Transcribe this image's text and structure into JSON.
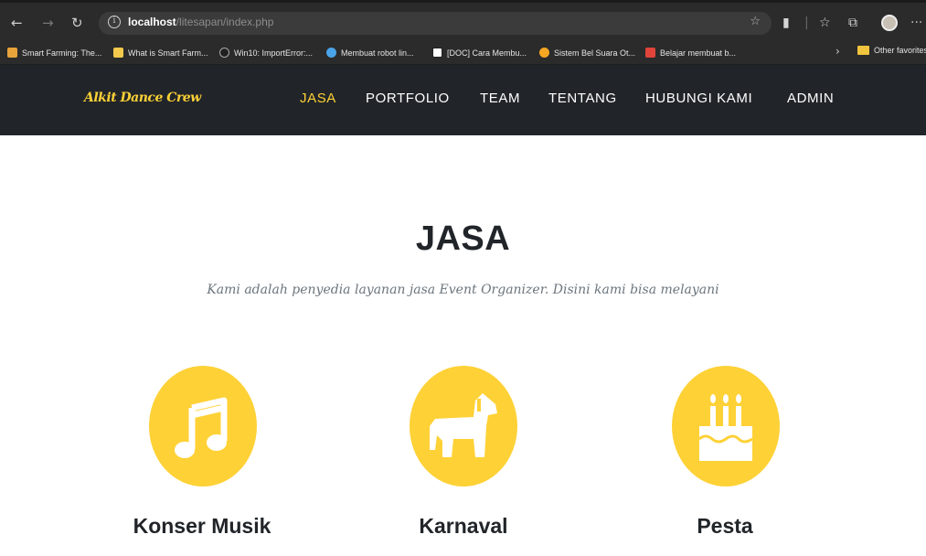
{
  "browser": {
    "url_host": "localhost",
    "url_path": "/litesapan/index.php",
    "bookmarks": [
      {
        "label": "Smart Farming: The...",
        "color": "#e8a33a"
      },
      {
        "label": "What is Smart Farm...",
        "color": "#f2c94c"
      },
      {
        "label": "Win10: ImportError:...",
        "color": "#202020"
      },
      {
        "label": "Membuat robot lin...",
        "color": "#4aa3e8"
      },
      {
        "label": "[DOC] Cara Membu...",
        "color": "#ffffff"
      },
      {
        "label": "Sistem Bel Suara Ot...",
        "color": "#f5a623"
      },
      {
        "label": "Belajar membuat b...",
        "color": "#e0443a"
      }
    ],
    "other_bookmarks": "Other favorites"
  },
  "navbar": {
    "brand": "Alkit Dance Crew",
    "items": [
      "JASA",
      "PORTFOLIO",
      "TEAM",
      "TENTANG",
      "HUBUNGI KAMI",
      "ADMIN"
    ],
    "active_item": "JASA"
  },
  "services": {
    "heading": "JASA",
    "subheading": "Kami adalah penyedia layanan jasa Event Organizer. Disini kami bisa melayani",
    "items": [
      {
        "title": "Konser Musik",
        "icon": "music-note-icon"
      },
      {
        "title": "Karnaval",
        "icon": "horse-icon"
      },
      {
        "title": "Pesta",
        "icon": "birthday-cake-icon"
      }
    ]
  },
  "colors": {
    "accent": "#fed136",
    "nav_bg": "#212529",
    "heading": "#212529",
    "subheading": "#6c757d"
  }
}
